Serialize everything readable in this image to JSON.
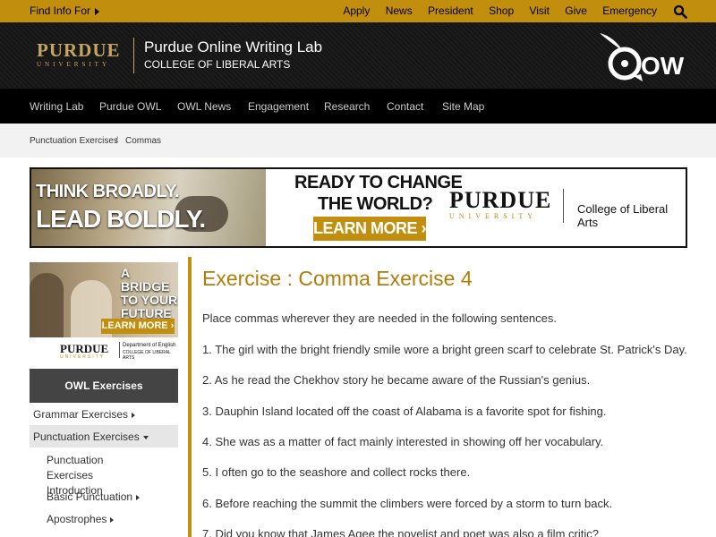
{
  "topbar": {
    "find_info": "Find Info For",
    "links": [
      "Apply",
      "News",
      "President",
      "Shop",
      "Visit",
      "Give",
      "Emergency"
    ],
    "search_icon": "search-icon"
  },
  "header": {
    "purdue_logo": "PURDUE",
    "purdue_logo_sub": "UNIVERSITY",
    "title": "Purdue Online Writing Lab",
    "subtitle": "COLLEGE OF LIBERAL ARTS",
    "owl_logo_text": "OWL"
  },
  "nav": [
    "Writing Lab",
    "Purdue OWL",
    "OWL News",
    "Engagement",
    "Research",
    "Contact",
    "Site Map"
  ],
  "breadcrumb": {
    "items": [
      "Punctuation Exercises",
      "Commas"
    ],
    "separator": "/"
  },
  "banner": {
    "left_line1": "THINK BROADLY.",
    "left_line2": "LEAD BOLDLY.",
    "headline_line1": "READY TO CHANGE",
    "headline_line2": "THE WORLD?",
    "cta": "LEARN MORE ›",
    "logo": "PURDUE",
    "logo_sub": "UNIVERSITY",
    "college": "College of Liberal Arts"
  },
  "side_ad": {
    "text": "A BRIDGE TO YOUR FUTURE",
    "cta": "LEARN MORE ›",
    "logo": "PURDUE",
    "logo_sub": "UNIVERSITY",
    "dept": "Department of English",
    "college": "COLLEGE OF LIBERAL ARTS"
  },
  "sidebar": {
    "heading": "OWL Exercises",
    "items": [
      {
        "label": "Grammar Exercises"
      },
      {
        "label": "Punctuation Exercises"
      },
      {
        "label": "Punctuation Exercises Introduction"
      },
      {
        "label": "Basic Punctuation"
      },
      {
        "label": "Apostrophes"
      }
    ]
  },
  "content": {
    "title": "Exercise : Comma Exercise 4",
    "instructions": "Place commas wherever they are needed in the following sentences.",
    "sentences": [
      "1. The girl with the bright friendly smile wore a bright green scarf to celebrate St. Patrick's Day.",
      "2. As he read the Chekhov story he became aware of the Russian's genius.",
      "3. Dauphin Island located off the coast of Alabama is a favorite spot for fishing.",
      "4. She was as a matter of fact mainly interested in showing off her vocabulary.",
      "5. I often go to the seashore and collect rocks there.",
      "6. Before reaching the summit the climbers were forced by a storm to turn back.",
      "7. Did you know that James Agee the novelist and poet was also a film critic?"
    ]
  },
  "colors": {
    "gold": "#c28e0e",
    "title_gold": "#b07d0a",
    "header_bg": "#1a1a1a",
    "nav_bg": "#000000",
    "sidebar_heading_bg": "#444444"
  }
}
